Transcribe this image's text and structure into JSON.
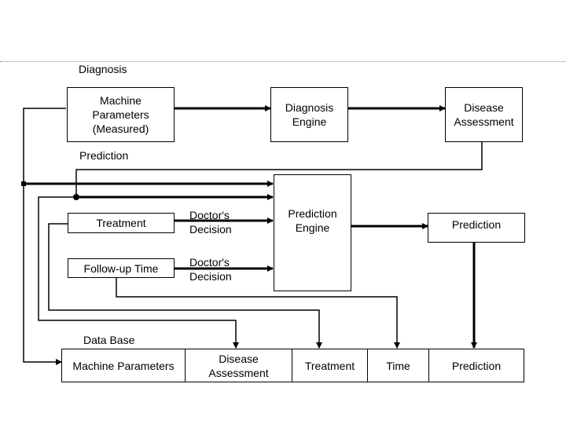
{
  "sections": {
    "diagnosis": "Diagnosis",
    "prediction": "Prediction",
    "database": "Data Base"
  },
  "diagnosis": {
    "machine_parameters": "Machine\nParameters\n(Measured)",
    "diagnosis_engine": "Diagnosis\nEngine",
    "disease_assessment": "Disease\nAssessment"
  },
  "prediction": {
    "treatment": "Treatment",
    "follow_up_time": "Follow-up Time",
    "doctors_decision_1": "Doctor's\nDecision",
    "doctors_decision_2": "Doctor's\nDecision",
    "prediction_engine": "Prediction\nEngine",
    "prediction_output": "Prediction"
  },
  "database": {
    "fields": [
      "Machine Parameters",
      "Disease\nAssessment",
      "Treatment",
      "Time",
      "Prediction"
    ]
  },
  "colors": {
    "line": "#000000",
    "top_rule": "#8a9a3a"
  }
}
